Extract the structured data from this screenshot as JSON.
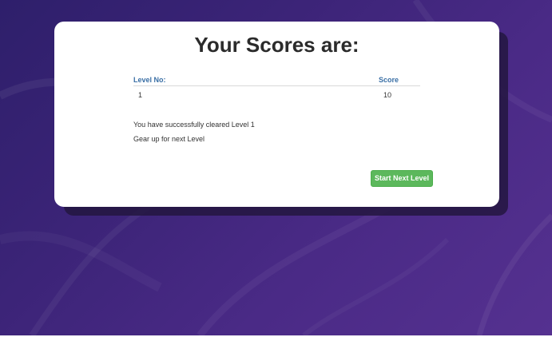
{
  "page": {
    "title": "Your Scores are:"
  },
  "scores": {
    "headers": {
      "level": "Level No:",
      "score": "Score"
    },
    "rows": [
      {
        "level": "1",
        "score": "10"
      }
    ]
  },
  "messages": {
    "cleared": "You have successfully cleared Level 1",
    "next": "Gear up for next Level"
  },
  "actions": {
    "next_level_label": "Start Next Level"
  },
  "colors": {
    "background": "#3c2478",
    "card": "#ffffff",
    "header_text": "#3a6fa5",
    "button": "#5cb85c"
  }
}
